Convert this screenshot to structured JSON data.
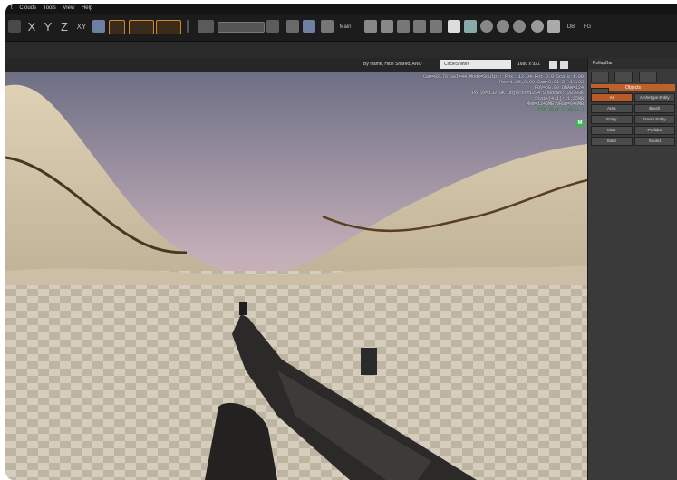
{
  "menu": {
    "items": [
      "t",
      "Clouds",
      "Tools",
      "View",
      "Help"
    ]
  },
  "toolbar": {
    "axis_x": "X",
    "axis_y": "Y",
    "axis_z": "Z",
    "axis_xy": "XY",
    "layer_label": "Main",
    "db_label": "DB",
    "fg_label": "FG"
  },
  "filter": {
    "text": "By Name, Hide Shared, ANO",
    "search_value": "CircleShifter",
    "resolution": "1680 x 921"
  },
  "stats": {
    "line1": "Cam=92.76 Sel=44 Mode=Sculpt: Pos 112.04 Rot 0.0 Scale 1.00",
    "line2": "Pos=1.25,0.00 Cam=0.21 Z: 17.33",
    "line3": "FOV=60.00 DRAW=124",
    "line4": "Polys=132.8K Objects=1234 Shadows: 28.93K",
    "line5": "Stats(4.1): 1.25MB",
    "line6": "Mem=1245MB VRam=640MB",
    "fps": "FPS 62.5 ( 82.1 )",
    "badge": "M"
  },
  "rollup": {
    "title": "RollupBar",
    "section": "Objects",
    "buttons": [
      "AI",
      "Archetype Entity",
      "Area",
      "Brush",
      "Entity",
      "Geom Entity",
      "Misc",
      "Prefabs",
      "Solid",
      "Sound"
    ],
    "selected": "AI"
  },
  "colors": {
    "accent": "#d08a2a",
    "panel_header": "#c0612a",
    "fps_green": "#4cd66a"
  }
}
